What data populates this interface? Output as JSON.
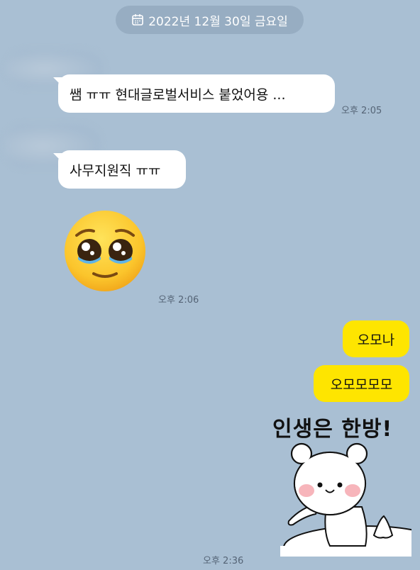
{
  "date_divider": {
    "text": "2022년 12월 30일 금요일"
  },
  "messages": [
    {
      "text": "쌤 ㅠㅠ 현대글로벌서비스 붙었어용 ...",
      "time": "오후 2:05"
    },
    {
      "text": "사무지원직 ㅠㅠ"
    },
    {
      "emoji": "pleading-face",
      "time": "오후 2:06"
    },
    {
      "text": "오모나"
    },
    {
      "text": "오모모모모"
    },
    {
      "sticker_text": "인생은 한방!",
      "time": "오후 2:36"
    }
  ],
  "colors": {
    "background": "#a9bfd3",
    "incoming_bubble": "#ffffff",
    "outgoing_bubble": "#fee500",
    "date_pill": "#97adc2"
  }
}
